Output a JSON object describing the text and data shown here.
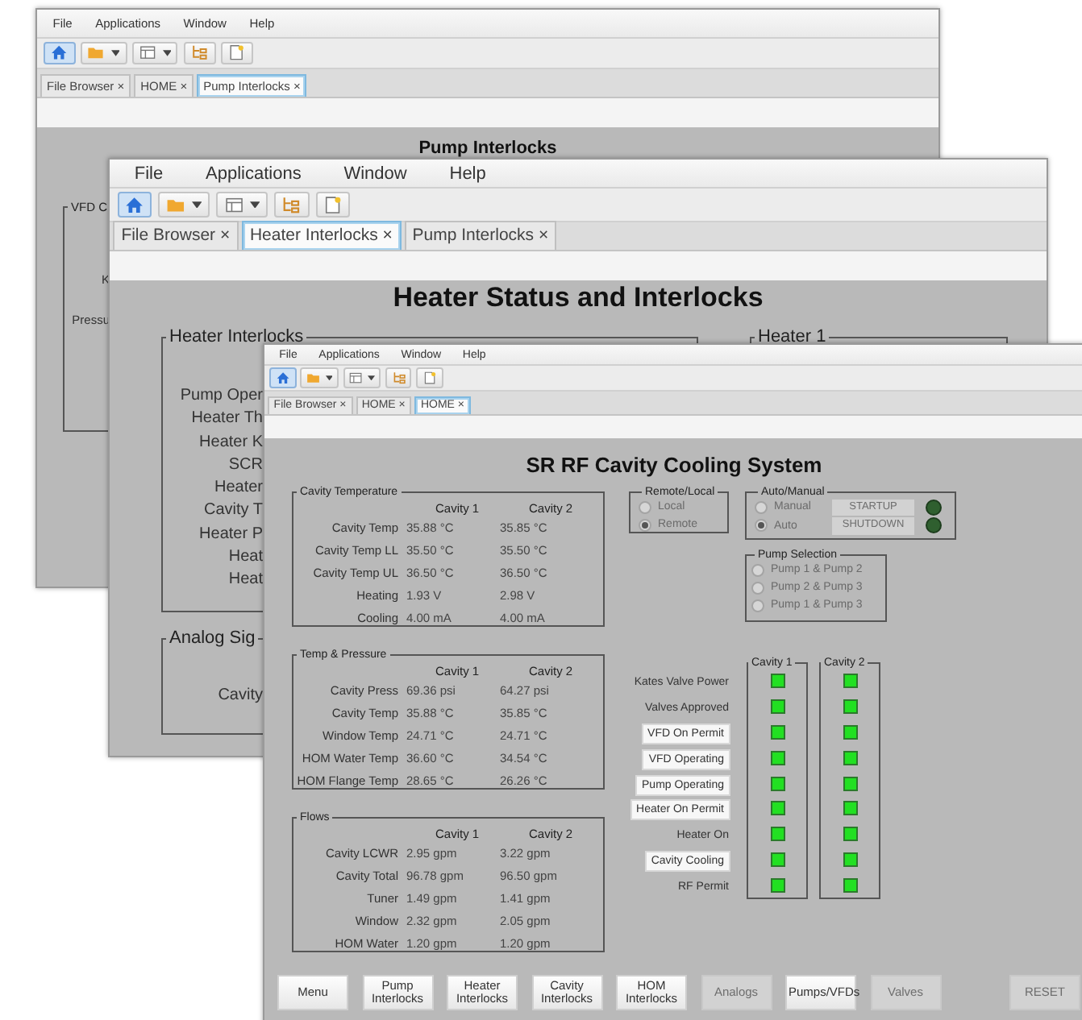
{
  "windows": [
    {
      "kind": "pump_interlocks",
      "menu": [
        "File",
        "Applications",
        "Window",
        "Help"
      ],
      "tabs": [
        {
          "label": "File Browser ×",
          "selected": false
        },
        {
          "label": "HOME ×",
          "selected": false
        },
        {
          "label": "Pump Interlocks ×",
          "selected": true
        }
      ],
      "title": "Pump Interlocks",
      "vfd_group": {
        "legend": "VFD C",
        "labels": [
          "K",
          "Pressu"
        ]
      }
    },
    {
      "kind": "heater_status",
      "menu": [
        "File",
        "Applications",
        "Window",
        "Help"
      ],
      "tabs": [
        {
          "label": "File Browser ×",
          "selected": false
        },
        {
          "label": "Heater Interlocks ×",
          "selected": true
        },
        {
          "label": "Pump Interlocks ×",
          "selected": false
        }
      ],
      "title": "Heater Status and Interlocks",
      "interlocks_group": {
        "legend": "Heater Interlocks",
        "labels": [
          "Pump Oper",
          "Heater Th",
          "Heater K",
          "SCR",
          "Heater",
          "Cavity T",
          "Heater P",
          "Heat",
          "Heat"
        ]
      },
      "heater_group": {
        "legend": "Heater 1"
      },
      "analog_group": {
        "legend": "Analog Sig",
        "labels": [
          "Cavity"
        ]
      }
    },
    {
      "kind": "cavity_cooling",
      "menu": [
        "File",
        "Applications",
        "Window",
        "Help"
      ],
      "tabs": [
        {
          "label": "File Browser ×",
          "selected": false
        },
        {
          "label": "HOME ×",
          "selected": false
        },
        {
          "label": "HOME ×",
          "selected": true
        }
      ],
      "title": "SR RF Cavity Cooling System",
      "tables": [
        {
          "legend": "Cavity Temperature",
          "columns": [
            "Cavity 1",
            "Cavity 2"
          ],
          "rows": [
            {
              "label": "Cavity Temp",
              "values": [
                "35.88 °C",
                "35.85 °C"
              ]
            },
            {
              "label": "Cavity Temp LL",
              "values": [
                "35.50 °C",
                "35.50 °C"
              ]
            },
            {
              "label": "Cavity Temp UL",
              "values": [
                "36.50 °C",
                "36.50 °C"
              ]
            },
            {
              "label": "Heating",
              "values": [
                "1.93 V",
                "2.98 V"
              ]
            },
            {
              "label": "Cooling",
              "values": [
                "4.00 mA",
                "4.00 mA"
              ]
            }
          ]
        },
        {
          "legend": "Temp & Pressure",
          "columns": [
            "Cavity 1",
            "Cavity 2"
          ],
          "rows": [
            {
              "label": "Cavity Press",
              "values": [
                "69.36 psi",
                "64.27 psi"
              ]
            },
            {
              "label": "Cavity Temp",
              "values": [
                "35.88 °C",
                "35.85 °C"
              ]
            },
            {
              "label": "Window Temp",
              "values": [
                "24.71 °C",
                "24.71 °C"
              ]
            },
            {
              "label": "HOM Water Temp",
              "values": [
                "36.60 °C",
                "34.54 °C"
              ]
            },
            {
              "label": "HOM Flange Temp",
              "values": [
                "28.65 °C",
                "26.26 °C"
              ]
            }
          ]
        },
        {
          "legend": "Flows",
          "columns": [
            "Cavity 1",
            "Cavity 2"
          ],
          "rows": [
            {
              "label": "Cavity LCWR",
              "values": [
                "2.95 gpm",
                "3.22 gpm"
              ]
            },
            {
              "label": "Cavity Total",
              "values": [
                "96.78 gpm",
                "96.50 gpm"
              ]
            },
            {
              "label": "Tuner",
              "values": [
                "1.49 gpm",
                "1.41 gpm"
              ]
            },
            {
              "label": "Window",
              "values": [
                "2.32 gpm",
                "2.05 gpm"
              ]
            },
            {
              "label": "HOM Water",
              "values": [
                "1.20 gpm",
                "1.20 gpm"
              ]
            }
          ]
        }
      ],
      "remote_local": {
        "legend": "Remote/Local",
        "disabled": true,
        "options": [
          {
            "label": "Local",
            "selected": false
          },
          {
            "label": "Remote",
            "selected": true
          }
        ]
      },
      "auto_manual": {
        "legend": "Auto/Manual",
        "disabled": true,
        "options": [
          {
            "label": "Manual",
            "selected": false
          },
          {
            "label": "Auto",
            "selected": true
          }
        ],
        "commands": [
          {
            "label": "STARTUP",
            "disabled": true,
            "lamp_on": false
          },
          {
            "label": "SHUTDOWN",
            "disabled": true,
            "lamp_on": false
          }
        ]
      },
      "pump_selection": {
        "legend": "Pump Selection",
        "disabled": true,
        "options": [
          {
            "label": "Pump 1 & Pump 2",
            "selected": false
          },
          {
            "label": "Pump 2 & Pump 3",
            "selected": false
          },
          {
            "label": "Pump 1 & Pump 3",
            "selected": false
          }
        ]
      },
      "indicators": {
        "columns": [
          "Cavity 1",
          "Cavity 2"
        ],
        "rows": [
          {
            "label": "Kates Valve Power",
            "kind": "label",
            "leds": [
              {
                "on": true
              },
              {
                "on": true
              }
            ]
          },
          {
            "label": "Valves Approved",
            "kind": "label",
            "leds": [
              {
                "on": true
              },
              {
                "on": true
              }
            ]
          },
          {
            "label": "VFD On Permit",
            "kind": "button",
            "leds": [
              {
                "on": true
              },
              {
                "on": true
              }
            ]
          },
          {
            "label": "VFD Operating",
            "kind": "button",
            "leds": [
              {
                "on": true
              },
              {
                "on": true
              }
            ]
          },
          {
            "label": "Pump Operating",
            "kind": "button",
            "leds": [
              {
                "on": true
              },
              {
                "on": true
              }
            ]
          },
          {
            "label": "Heater On Permit",
            "kind": "button",
            "leds": [
              {
                "on": true
              },
              {
                "on": true
              }
            ]
          },
          {
            "label": "Heater On",
            "kind": "label",
            "leds": [
              {
                "on": true
              },
              {
                "on": true
              }
            ]
          },
          {
            "label": "Cavity Cooling",
            "kind": "button",
            "leds": [
              {
                "on": true
              },
              {
                "on": true
              }
            ]
          },
          {
            "label": "RF Permit",
            "kind": "label",
            "leds": [
              {
                "on": true
              },
              {
                "on": true
              }
            ]
          }
        ]
      },
      "buttons": [
        {
          "label": "Menu",
          "disabled": false
        },
        {
          "label": "Pump Interlocks",
          "disabled": false
        },
        {
          "label": "Heater Interlocks",
          "disabled": false
        },
        {
          "label": "Cavity Interlocks",
          "disabled": false
        },
        {
          "label": "HOM Interlocks",
          "disabled": false
        },
        {
          "label": "Analogs",
          "disabled": true
        },
        {
          "label": "Pumps/VFDs",
          "disabled": false
        },
        {
          "label": "Valves",
          "disabled": true
        },
        {
          "label": "RESET",
          "disabled": true
        }
      ]
    }
  ]
}
